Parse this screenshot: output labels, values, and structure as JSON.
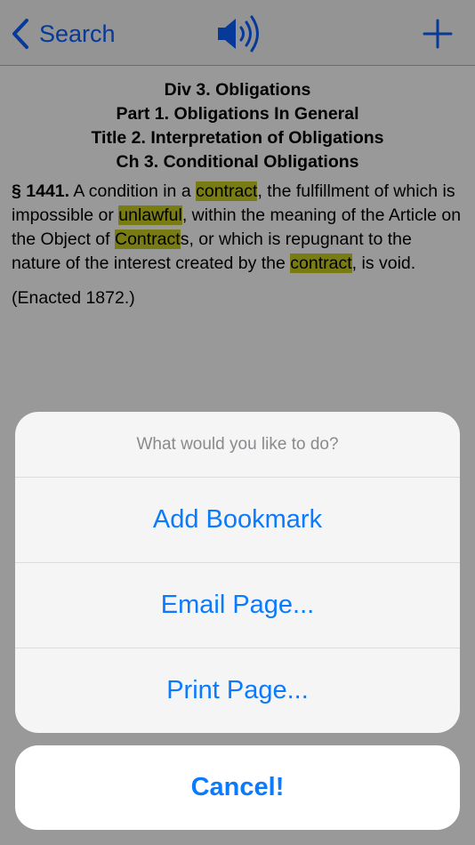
{
  "nav": {
    "back_label": "Search",
    "speaker_icon": "speaker-icon",
    "add_icon": "plus-icon"
  },
  "content": {
    "hierarchy": [
      "Div 3. Obligations",
      "Part 1. Obligations In General",
      "Title 2. Interpretation of Obligations",
      "Ch 3. Conditional Obligations"
    ],
    "section_number": "§ 1441.",
    "section_segments": [
      {
        "text": " A condition in a ",
        "highlight": false
      },
      {
        "text": "contract",
        "highlight": true
      },
      {
        "text": ", the fulfillment of which is impossible or ",
        "highlight": false
      },
      {
        "text": "unlawful",
        "highlight": true
      },
      {
        "text": ", within the meaning of the Article on the Object of ",
        "highlight": false
      },
      {
        "text": "Contract",
        "highlight": true
      },
      {
        "text": "s, or which is repugnant to the nature of the interest created by the ",
        "highlight": false
      },
      {
        "text": "contract",
        "highlight": true
      },
      {
        "text": ", is void.",
        "highlight": false
      }
    ],
    "enacted": "(Enacted 1872.)"
  },
  "action_sheet": {
    "title": "What would you like to do?",
    "options": [
      "Add Bookmark",
      "Email Page...",
      "Print Page..."
    ],
    "cancel_label": "Cancel!"
  },
  "colors": {
    "accent": "#0a7aff",
    "highlight": "#c8cf1e",
    "nav_background": "#f7f7f7"
  }
}
